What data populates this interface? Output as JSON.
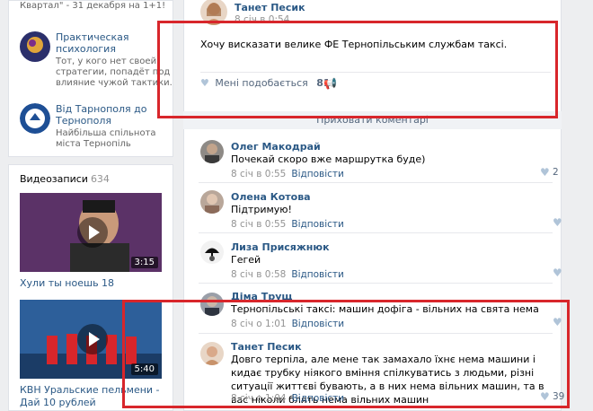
{
  "left": {
    "top_item": {
      "text": "Квартал\" - 31 декабря на 1+1!"
    },
    "groups": [
      {
        "name": "Практическая психология",
        "desc": "Тот, у кого нет своей стратегии, попадёт под влияние чужой тактики."
      },
      {
        "name": "Від Тарнополя до Тернополя",
        "desc": "Найбільша спільнота міста Тернопіль"
      }
    ],
    "videos": {
      "title": "Видеозаписи",
      "count": "634",
      "items": [
        {
          "duration": "3:15",
          "caption": "Хули ты ноешь 18"
        },
        {
          "duration": "5:40",
          "caption": "КВН Уральские пельмени - Дай 10 рублей"
        }
      ]
    }
  },
  "post": {
    "author": "Танет Песик",
    "time": "8 січ в 0:54",
    "text": "Хочу висказати велике ФЕ Тернопільським службам таксі.",
    "like_label": "Мені подобається",
    "like_count": "81",
    "hide_comments": "Приховати коментарі"
  },
  "comments": [
    {
      "author": "Олег Макодрай",
      "text": "Почекай скоро вже маршрутка буде)",
      "time": "8 січ в 0:55",
      "reply": "Відповісти",
      "likes": "2"
    },
    {
      "author": "Олена Котова",
      "text": "Підтримую!",
      "time": "8 січ в 0:55",
      "reply": "Відповісти",
      "likes": ""
    },
    {
      "author": "Лиза Присяжнюк",
      "text": "Гегей",
      "time": "8 січ в 0:58",
      "reply": "Відповісти",
      "likes": ""
    },
    {
      "author": "Діма Трущ",
      "text": "Тернопільські таксі: машин дофіга - вільних на свята нема",
      "time": "8 січ о 1:01",
      "reply": "Відповісти",
      "likes": ""
    },
    {
      "author": "Танет Песик",
      "text": "Довго терпіла, але мене так замахало їхнє нема машини і кидає трубку ніякого вміння спілкуватись з людьми, різні ситуації життєві бувають, а в них нема вільних машин, та в вас ніколи блять нема вільних машин",
      "time": "8 січ о 1:04",
      "reply": "Відповісти",
      "likes": "39"
    }
  ],
  "colors": {
    "link": "#2a5885",
    "highlight": "#d8262b"
  }
}
